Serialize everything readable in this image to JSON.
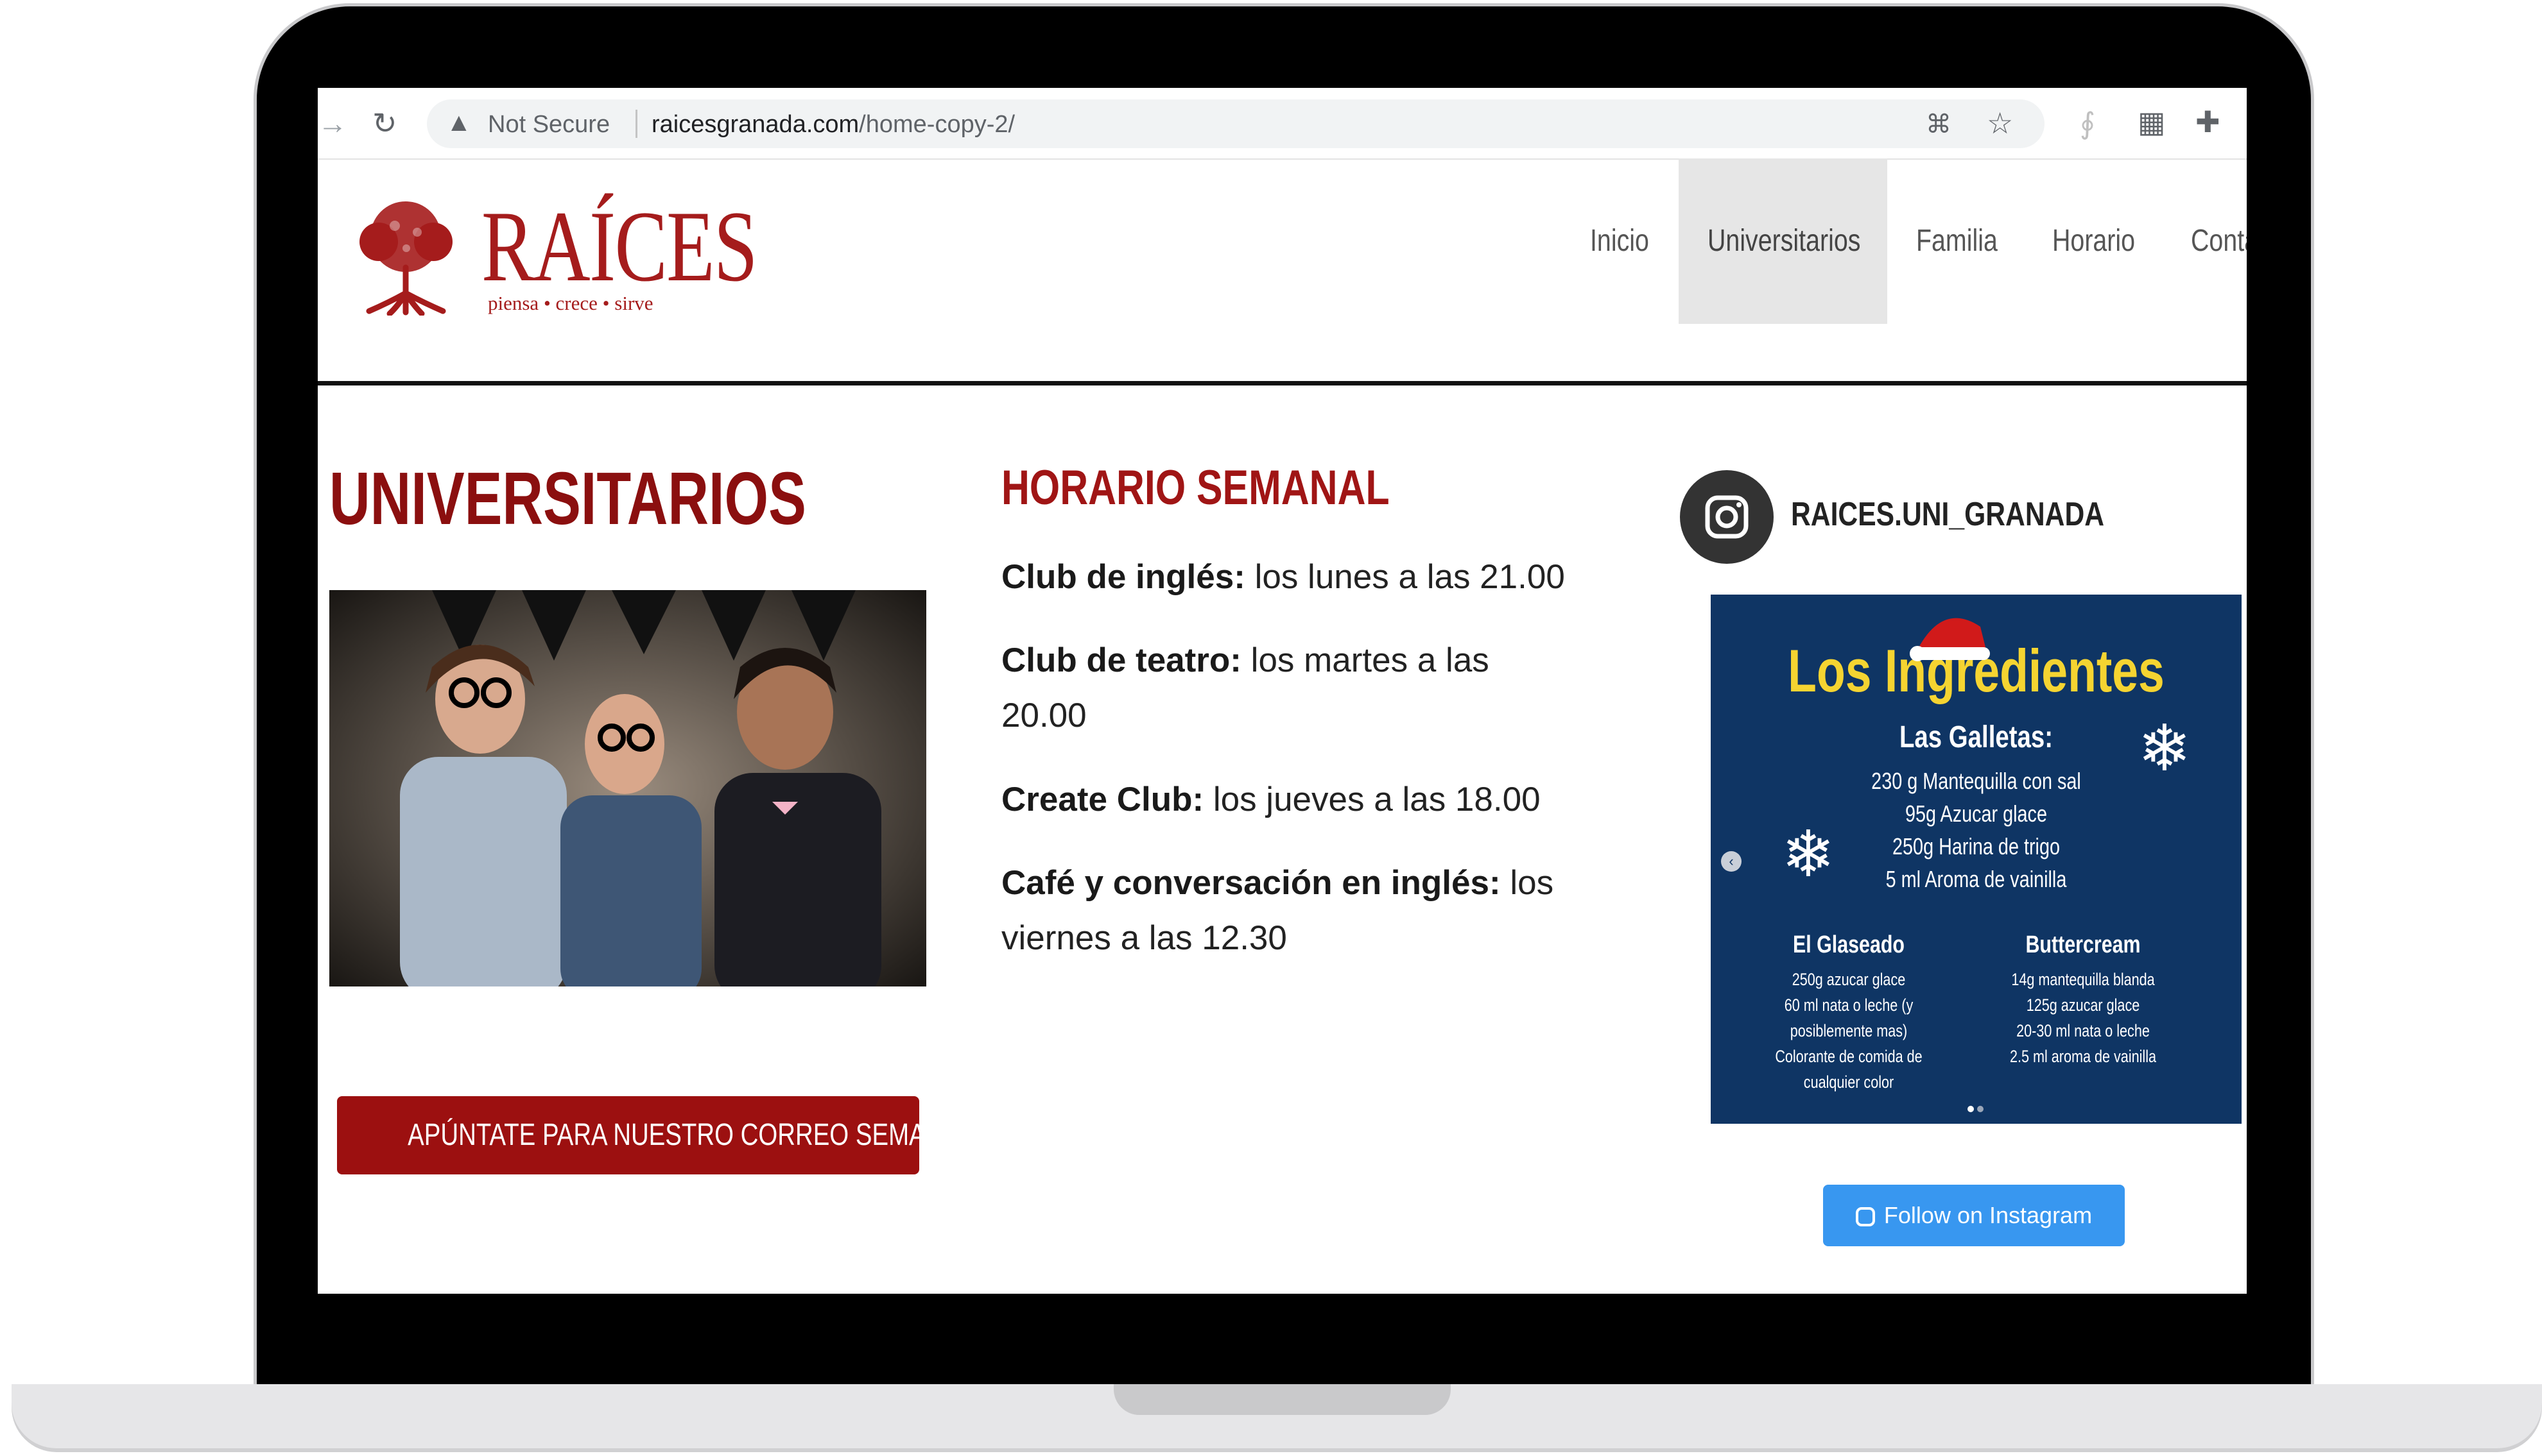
{
  "browser": {
    "security_label": "Not Secure",
    "url_host": "raicesgranada.com",
    "url_path": "/home-copy-2/"
  },
  "site": {
    "logo": {
      "wordmark": "RAÍCES",
      "tagline": "piensa  •  crece  •  sirve"
    },
    "nav": [
      {
        "label": "Inicio",
        "active": false
      },
      {
        "label": "Universitarios",
        "active": true
      },
      {
        "label": "Familia",
        "active": false
      },
      {
        "label": "Horario",
        "active": false
      },
      {
        "label": "Conta",
        "active": false
      }
    ]
  },
  "main": {
    "title": "UNIVERSITARIOS",
    "cta_label": "APÚNTATE PARA NUESTRO CORREO SEMANAL",
    "schedule": {
      "title": "HORARIO SEMANAL",
      "items": [
        {
          "label": "Club de inglés:",
          "text": " los lunes a las 21.00"
        },
        {
          "label": "Club de teatro:",
          "text": " los martes a las 20.00"
        },
        {
          "label": "Create Club:",
          "text": " los jueves a las 18.00"
        },
        {
          "label": "Café y conversación en inglés:",
          "text": " los viernes a las 12.30"
        }
      ]
    }
  },
  "instagram": {
    "handle": "RAICES.UNI_GRANADA",
    "follow_label": "Follow on Instagram",
    "post": {
      "title": "Los Ingredientes",
      "galletas_title": "Las Galletas:",
      "galletas": [
        "230 g Mantequilla con sal",
        "95g Azucar glace",
        "250g Harina de trigo",
        "5 ml Aroma de vainilla"
      ],
      "glaseado_title": "El Glaseado",
      "glaseado": [
        "250g azucar glace",
        "60 ml nata o leche (y",
        "posiblemente mas)",
        "Colorante de comida de",
        "cualquier color"
      ],
      "buttercream_title": "Buttercream",
      "buttercream": [
        "14g mantequilla blanda",
        "125g azucar glace",
        "20-30 ml nata o leche",
        "2.5 ml aroma de vainilla"
      ]
    }
  },
  "colors": {
    "brand_red": "#a51c1c",
    "ig_blue": "#3897f0",
    "post_bg": "#0f3564",
    "post_title": "#f5d431"
  }
}
